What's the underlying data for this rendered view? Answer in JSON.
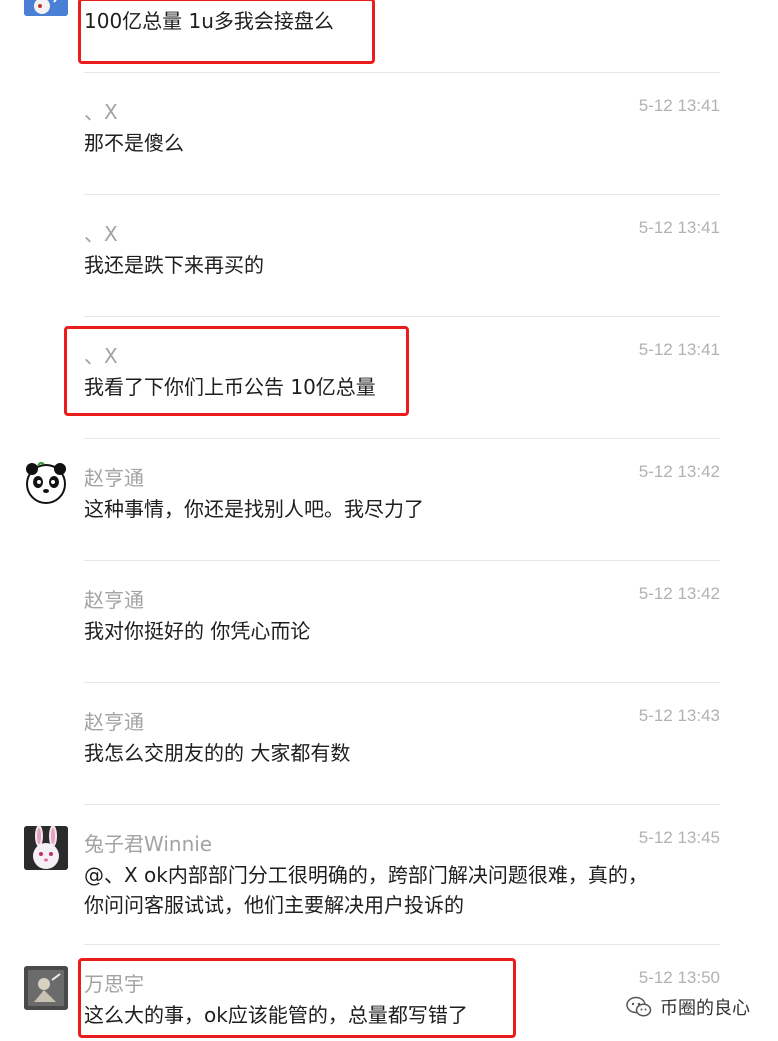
{
  "messages": [
    {
      "name": "",
      "time": "",
      "text": "100亿总量 1u多我会接盘么"
    },
    {
      "name": "、X",
      "time": "5-12 13:41",
      "text": "那不是傻么"
    },
    {
      "name": "、X",
      "time": "5-12 13:41",
      "text": "我还是跌下来再买的"
    },
    {
      "name": "、X",
      "time": "5-12 13:41",
      "text": "我看了下你们上币公告 10亿总量"
    },
    {
      "name": "赵亨通",
      "time": "5-12 13:42",
      "text": "这种事情，你还是找别人吧。我尽力了"
    },
    {
      "name": "赵亨通",
      "time": "5-12 13:42",
      "text": "我对你挺好的 你凭心而论"
    },
    {
      "name": "赵亨通",
      "time": "5-12 13:43",
      "text": "我怎么交朋友的的 大家都有数"
    },
    {
      "name": "兔子君Winnie",
      "time": "5-12 13:45",
      "text_line1": "@、X  ok内部部门分工很明确的，跨部门解决问题很难，真的，",
      "text_line2": "你问问客服试试，他们主要解决用户投诉的"
    },
    {
      "name": "万思宇",
      "time": "5-12 13:50",
      "text": "这么大的事，ok应该能管的，总量都写错了"
    }
  ],
  "watermark": {
    "label": "币圈的良心",
    "icon": "wechat-icon"
  },
  "colors": {
    "highlight": "#ea1c1c",
    "name": "#a3a3a3",
    "time": "#b2b2b2",
    "text": "#1e1e1e",
    "divider": "#e6e6e6"
  }
}
